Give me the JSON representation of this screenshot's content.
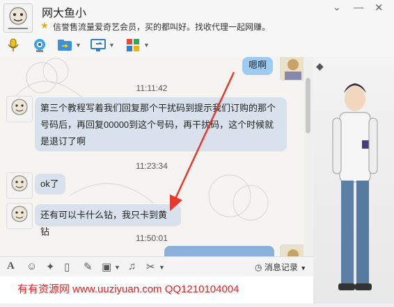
{
  "contact": {
    "name": "网大鱼小",
    "signature": "信誉售流量爱奇艺会员，买的都叫好。找收代理一起网赚。"
  },
  "toolbar": {
    "icons": [
      "microphone-icon",
      "video-call-icon",
      "file-transfer-icon",
      "screen-share-icon",
      "apps-icon"
    ]
  },
  "messages": [
    {
      "side": "right",
      "text": "嗯啊",
      "kind": "mine"
    },
    {
      "kind": "time",
      "text": "11:11:42"
    },
    {
      "side": "left",
      "text": "第三个教程写着我们回复那个干扰码到提示我们订购的那个号码后，再回复00000到这个号码，再干扰码，这个时候就是退订了啊"
    },
    {
      "kind": "time",
      "text": "11:23:34"
    },
    {
      "side": "left",
      "text": "ok了"
    },
    {
      "side": "left",
      "text": "还有可以卡什么钻，我只卡到黄钻"
    },
    {
      "kind": "time",
      "text": "11:50:01"
    }
  ],
  "input_toolbar": {
    "history_label": "消息记录",
    "icons": [
      "font-icon",
      "emoji-icon",
      "magic-icon",
      "vibrate-icon",
      "edit-icon",
      "image-icon",
      "music-icon",
      "scissors-icon"
    ]
  },
  "watermark": "有有资源网 www.uuziyuan.com QQ1210104004",
  "colors": {
    "bubble_incoming": "#d9e2ec",
    "bubble_outgoing": "#9ecbf2",
    "arrow": "#e8392f",
    "watermark": "#e02020"
  }
}
